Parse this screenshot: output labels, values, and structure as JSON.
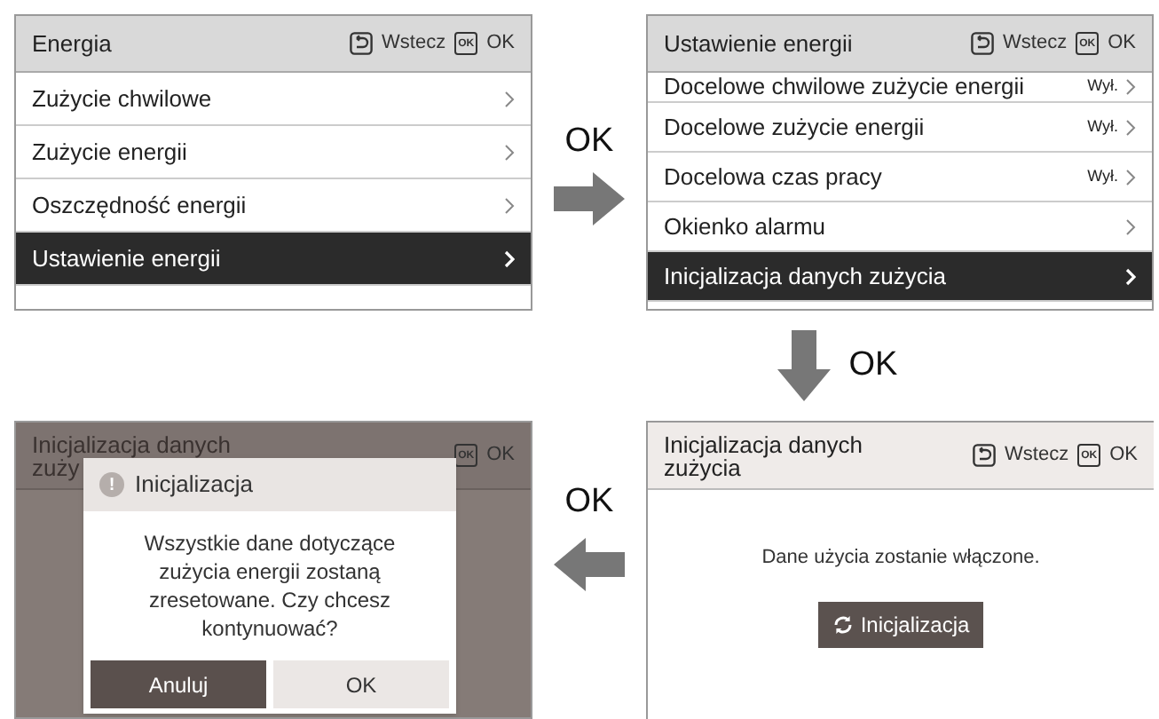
{
  "screens": [
    {
      "kind": "menu",
      "title": "Energia",
      "actions": [
        {
          "kind": "back",
          "label": "Wstecz"
        },
        {
          "kind": "ok",
          "key": "OK",
          "label": "OK"
        }
      ],
      "items": [
        {
          "label": "Zużycie chwilowe",
          "selected": false
        },
        {
          "label": "Zużycie energii",
          "selected": false
        },
        {
          "label": "Oszczędność energii",
          "selected": false
        },
        {
          "label": "Ustawienie energii",
          "selected": true
        }
      ]
    },
    {
      "kind": "menu",
      "title": "Ustawienie energii",
      "actions": [
        {
          "kind": "back",
          "label": "Wstecz"
        },
        {
          "kind": "ok",
          "key": "OK",
          "label": "OK"
        }
      ],
      "items": [
        {
          "label": "Docelowe chwilowe zużycie energii",
          "value": "Wył.",
          "selected": false
        },
        {
          "label": "Docelowe zużycie energii",
          "value": "Wył.",
          "selected": false
        },
        {
          "label": "Docelowa czas pracy",
          "value": "Wył.",
          "selected": false
        },
        {
          "label": "Okienko alarmu",
          "selected": false
        },
        {
          "label": "Inicjalizacja danych zużycia",
          "selected": true
        }
      ]
    },
    {
      "kind": "dialog",
      "title": "Inicjalizacja danych zuży",
      "actions": [
        {
          "kind": "ok",
          "key": "OK",
          "label": "OK"
        }
      ],
      "dialog": {
        "icon": "!",
        "title": "Inicjalizacja",
        "message": "Wszystkie dane dotyczące zużycia energii zostaną zresetowane. Czy chcesz kontynuować?",
        "buttons": [
          {
            "label": "Anuluj",
            "selected": true
          },
          {
            "label": "OK",
            "selected": false
          }
        ]
      }
    },
    {
      "kind": "info",
      "title": "Inicjalizacja danych zużycia",
      "actions": [
        {
          "kind": "back",
          "label": "Wstecz"
        },
        {
          "kind": "ok",
          "key": "OK",
          "label": "OK"
        }
      ],
      "message": "Dane użycia zostanie włączone.",
      "button": "Inicjalizacja"
    }
  ],
  "transitions": [
    {
      "label": "OK",
      "kind": "right"
    },
    {
      "label": "OK",
      "kind": "down"
    },
    {
      "label": "OK",
      "kind": "left"
    }
  ]
}
